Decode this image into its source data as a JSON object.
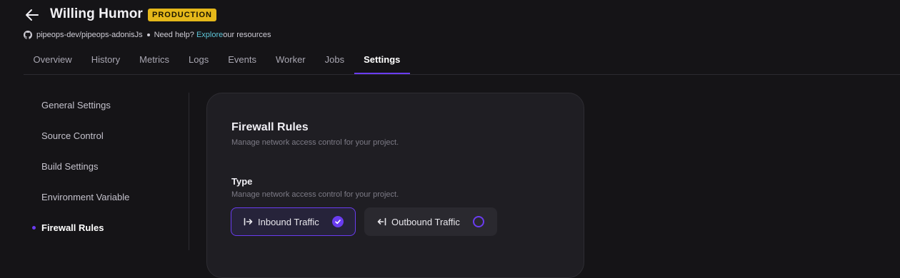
{
  "header": {
    "title": "Willing Humor",
    "badge": "PRODUCTION",
    "repo": "pipeops-dev/pipeops-adonisJs",
    "help_text": "Need help?",
    "help_link": "Explore",
    "help_suffix": "our resources"
  },
  "tabs": [
    {
      "label": "Overview"
    },
    {
      "label": "History"
    },
    {
      "label": "Metrics"
    },
    {
      "label": "Logs"
    },
    {
      "label": "Events"
    },
    {
      "label": "Worker"
    },
    {
      "label": "Jobs"
    },
    {
      "label": "Settings",
      "active": true
    }
  ],
  "sidebar": {
    "items": [
      {
        "label": "General Settings"
      },
      {
        "label": "Source Control"
      },
      {
        "label": "Build Settings"
      },
      {
        "label": "Environment Variable"
      },
      {
        "label": "Firewall Rules",
        "active": true
      }
    ]
  },
  "card": {
    "title": "Firewall Rules",
    "subtitle": "Manage network access control for your project.",
    "type_label": "Type",
    "type_subtitle": "Manage network access control for your project.",
    "options": [
      {
        "label": "Inbound Traffic",
        "selected": true,
        "icon": "inbound-arrow-icon"
      },
      {
        "label": "Outbound Traffic",
        "selected": false,
        "icon": "outbound-arrow-icon"
      }
    ]
  },
  "colors": {
    "accent": "#6a3cf0",
    "badge": "#e5b81a",
    "link": "#5ec6d9",
    "background": "#151417",
    "card": "#1f1e23"
  }
}
